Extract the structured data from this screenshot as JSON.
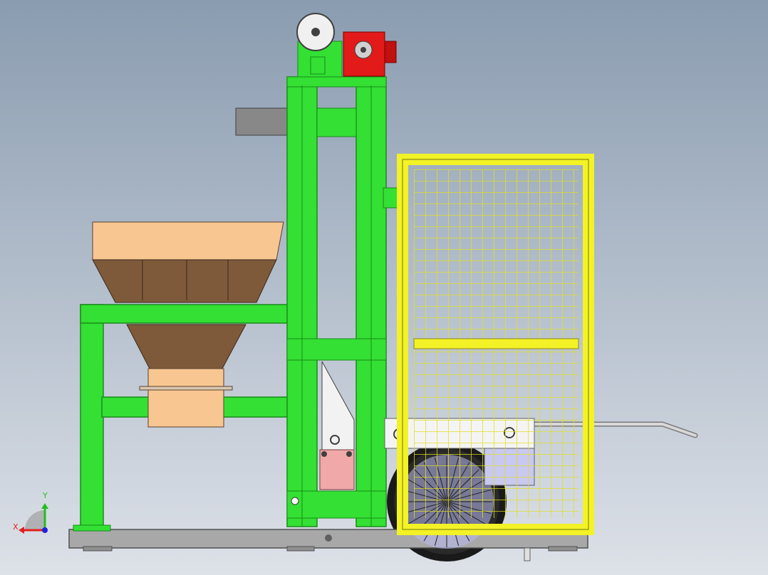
{
  "viewport": {
    "background_top": "#8a9cb0",
    "background_bottom": "#dde1e8"
  },
  "colors": {
    "frame_green": "#33e033",
    "frame_green_dark": "#1a8a1a",
    "hopper_light": "#f8c690",
    "hopper_dark": "#7e5a3a",
    "motor_red": "#e21a1a",
    "cage_yellow": "#f2f226",
    "cage_yellow_dark": "#8a8a10",
    "base_gray": "#a8a8a8",
    "tire_black": "#1a1a1a",
    "wheel_blue": "#b8b8f0",
    "plate_pink": "#f0a8a8",
    "handle_gray": "#c8c8c8"
  },
  "triad": {
    "x_label": "X",
    "y_label": "Y",
    "x_color": "#e02020",
    "y_color": "#20c020",
    "z_color": "#2020e0"
  },
  "icons": [
    "coordinate-triad-icon"
  ]
}
